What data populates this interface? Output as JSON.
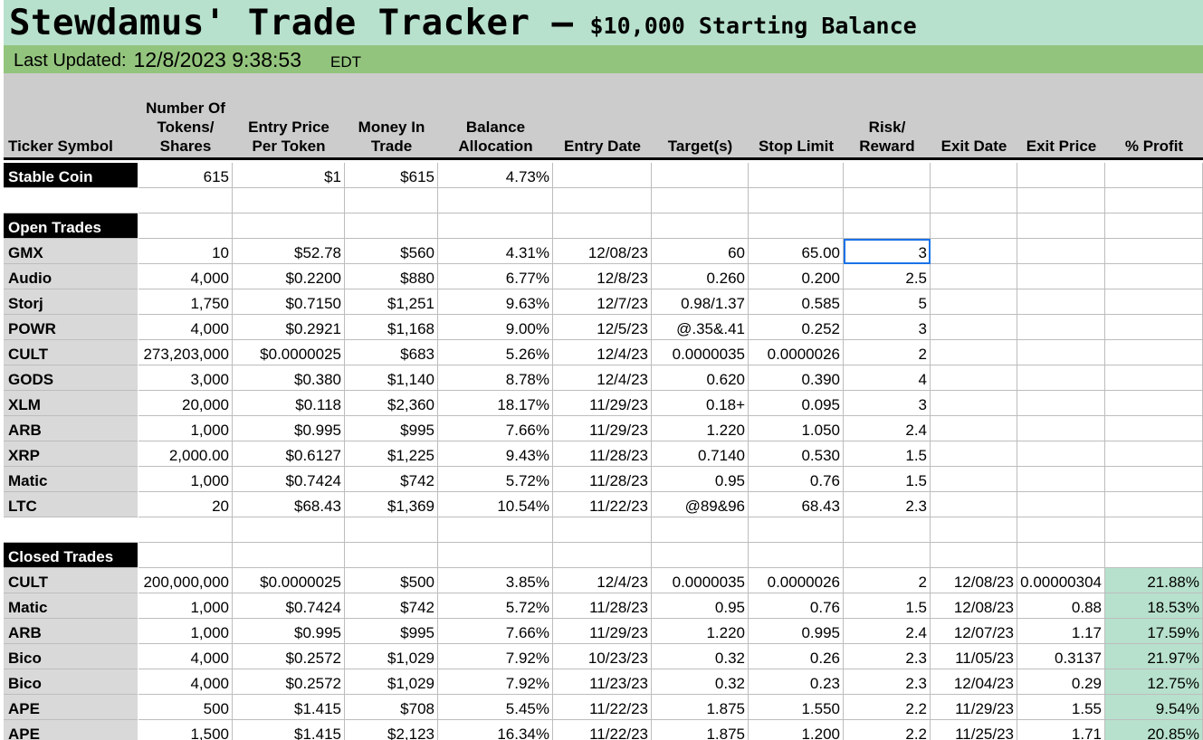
{
  "title": {
    "main": "Stewdamus' Trade Tracker –",
    "sub": "$10,000 Starting Balance"
  },
  "updated": {
    "label": "Last Updated:",
    "value": "12/8/2023 9:38:53",
    "tz": "EDT"
  },
  "headers": [
    "Ticker Symbol",
    "Number Of\nTokens/\nShares",
    "Entry Price\nPer Token",
    "Money In\nTrade",
    "Balance\nAllocation",
    "Entry Date",
    "Target(s)",
    "Stop Limit",
    "Risk/\nReward",
    "Exit Date",
    "Exit Price",
    "% Profit"
  ],
  "stable": {
    "label": "Stable Coin",
    "cells": [
      "615",
      "$1",
      "$615",
      "4.73%",
      "",
      "",
      "",
      "",
      "",
      "",
      ""
    ]
  },
  "open_label": "Open Trades",
  "open_trades": [
    [
      "GMX",
      "10",
      "$52.78",
      "$560",
      "4.31%",
      "12/08/23",
      "60",
      "65.00",
      "3",
      "",
      "",
      ""
    ],
    [
      "Audio",
      "4,000",
      "$0.2200",
      "$880",
      "6.77%",
      "12/8/23",
      "0.260",
      "0.200",
      "2.5",
      "",
      "",
      ""
    ],
    [
      "Storj",
      "1,750",
      "$0.7150",
      "$1,251",
      "9.63%",
      "12/7/23",
      "0.98/1.37",
      "0.585",
      "5",
      "",
      "",
      ""
    ],
    [
      "POWR",
      "4,000",
      "$0.2921",
      "$1,168",
      "9.00%",
      "12/5/23",
      "@.35&.41",
      "0.252",
      "3",
      "",
      "",
      ""
    ],
    [
      "CULT",
      "273,203,000",
      "$0.0000025",
      "$683",
      "5.26%",
      "12/4/23",
      "0.0000035",
      "0.0000026",
      "2",
      "",
      "",
      ""
    ],
    [
      "GODS",
      "3,000",
      "$0.380",
      "$1,140",
      "8.78%",
      "12/4/23",
      "0.620",
      "0.390",
      "4",
      "",
      "",
      ""
    ],
    [
      "XLM",
      "20,000",
      "$0.118",
      "$2,360",
      "18.17%",
      "11/29/23",
      "0.18+",
      "0.095",
      "3",
      "",
      "",
      ""
    ],
    [
      "ARB",
      "1,000",
      "$0.995",
      "$995",
      "7.66%",
      "11/29/23",
      "1.220",
      "1.050",
      "2.4",
      "",
      "",
      ""
    ],
    [
      "XRP",
      "2,000.00",
      "$0.6127",
      "$1,225",
      "9.43%",
      "11/28/23",
      "0.7140",
      "0.530",
      "1.5",
      "",
      "",
      ""
    ],
    [
      "Matic",
      "1,000",
      "$0.7424",
      "$742",
      "5.72%",
      "11/28/23",
      "0.95",
      "0.76",
      "1.5",
      "",
      "",
      ""
    ],
    [
      "LTC",
      "20",
      "$68.43",
      "$1,369",
      "10.54%",
      "11/22/23",
      "@89&96",
      "68.43",
      "2.3",
      "",
      "",
      ""
    ]
  ],
  "closed_label": "Closed Trades",
  "closed_trades": [
    [
      "CULT",
      "200,000,000",
      "$0.0000025",
      "$500",
      "3.85%",
      "12/4/23",
      "0.0000035",
      "0.0000026",
      "2",
      "12/08/23",
      "0.00000304",
      "21.88%"
    ],
    [
      "Matic",
      "1,000",
      "$0.7424",
      "$742",
      "5.72%",
      "11/28/23",
      "0.95",
      "0.76",
      "1.5",
      "12/08/23",
      "0.88",
      "18.53%"
    ],
    [
      "ARB",
      "1,000",
      "$0.995",
      "$995",
      "7.66%",
      "11/29/23",
      "1.220",
      "0.995",
      "2.4",
      "12/07/23",
      "1.17",
      "17.59%"
    ],
    [
      "Bico",
      "4,000",
      "$0.2572",
      "$1,029",
      "7.92%",
      "10/23/23",
      "0.32",
      "0.26",
      "2.3",
      "11/05/23",
      "0.3137",
      "21.97%"
    ],
    [
      "Bico",
      "4,000",
      "$0.2572",
      "$1,029",
      "7.92%",
      "11/23/23",
      "0.32",
      "0.23",
      "2.3",
      "12/04/23",
      "0.29",
      "12.75%"
    ],
    [
      "APE",
      "500",
      "$1.415",
      "$708",
      "5.45%",
      "11/22/23",
      "1.875",
      "1.550",
      "2.2",
      "11/29/23",
      "1.55",
      "9.54%"
    ],
    [
      "APE",
      "1,500",
      "$1.415",
      "$2,123",
      "16.34%",
      "11/22/23",
      "1.875",
      "1.200",
      "2.2",
      "11/25/23",
      "1.71",
      "20.85%"
    ]
  ],
  "colors": {
    "title_band": "#b7e1cd",
    "updated_band": "#93c47d",
    "header_band": "#cccccc",
    "ticker_gray": "#d9d9d9",
    "profit_green": "#b7e1cd",
    "selection": "#1a73e8"
  }
}
